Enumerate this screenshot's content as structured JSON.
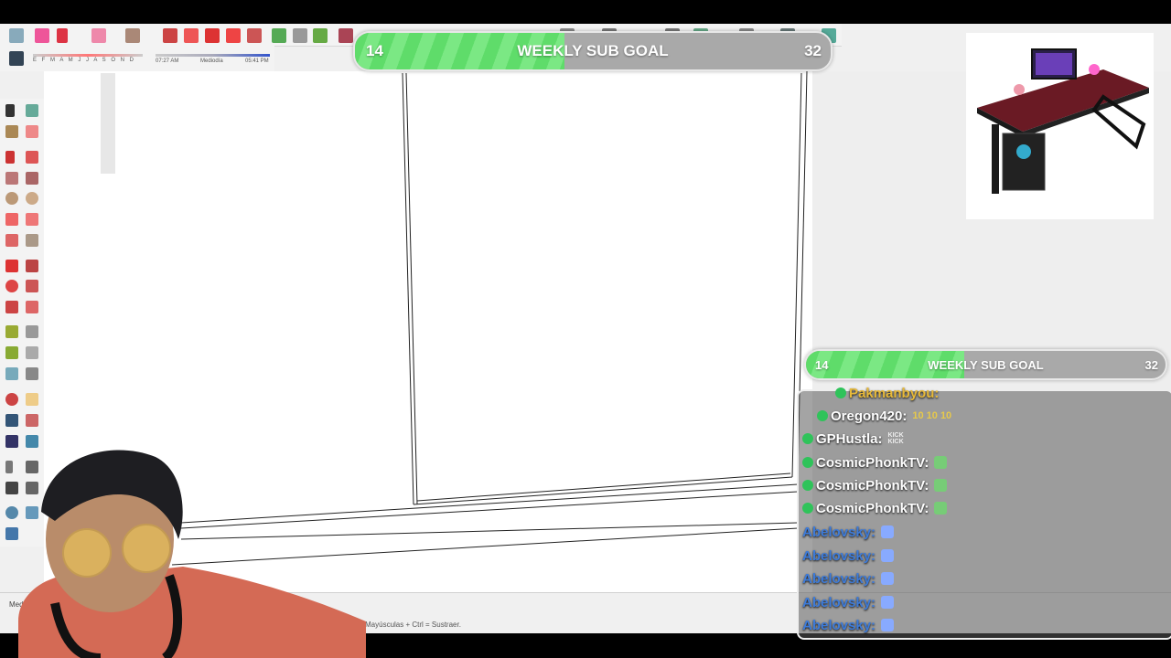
{
  "colors": {
    "goal_fill": "#5fdc6a",
    "goal_bg": "#a9a9a9",
    "chat_sub": "#ffffff",
    "chat_nonsub": "#3d7bd9",
    "badge": "#2fc35a"
  },
  "toolbar": {
    "icons": [
      "select-icon",
      "eraser-icon",
      "pencil-icon",
      "pencil-dropdown-icon",
      "arc-icon",
      "arc-dropdown-icon",
      "rectangle-icon",
      "rectangle-dropdown-icon",
      "push-pull-icon",
      "follow-me-icon",
      "move-icon",
      "rotate-icon",
      "scale-icon",
      "tape-measure-icon",
      "text-icon",
      "paint-bucket-icon",
      "components-icon"
    ],
    "shadow_months": "E F M A M J J A S O N D",
    "time_start": "07:27 AM",
    "time_mid": "Mediodía",
    "time_end": "05:41 PM"
  },
  "goal_top": {
    "current": "14",
    "title": "WEEKLY SUB GOAL",
    "target": "32",
    "progress": 0.44
  },
  "goal_right": {
    "current": "14",
    "title": "WEEKLY SUB GOAL",
    "target": "32",
    "progress": 0.44
  },
  "chat": {
    "messages": [
      {
        "user": "Pakmanbyou:",
        "subscriber": true,
        "emote": ""
      },
      {
        "user": "Oregon420:",
        "subscriber": true,
        "emote": "10 10 10"
      },
      {
        "user": "GPHustla:",
        "subscriber": true,
        "emote": "KICK KICK"
      },
      {
        "user": "CosmicPhonkTV:",
        "subscriber": true,
        "emote": ""
      },
      {
        "user": "CosmicPhonkTV:",
        "subscriber": true,
        "emote": ""
      },
      {
        "user": "CosmicPhonkTV:",
        "subscriber": true,
        "emote": ""
      },
      {
        "user": "Abelovsky:",
        "subscriber": false,
        "emote": ""
      },
      {
        "user": "Abelovsky:",
        "subscriber": false,
        "emote": ""
      },
      {
        "user": "Abelovsky:",
        "subscriber": false,
        "emote": ""
      },
      {
        "user": "Abelovsky:",
        "subscriber": false,
        "emote": ""
      },
      {
        "user": "Abelovsky:",
        "subscriber": false,
        "emote": ""
      }
    ]
  },
  "status": {
    "measurements_label": "Medidas",
    "hint": "Mayúsculas + Ctrl = Sustraer."
  }
}
